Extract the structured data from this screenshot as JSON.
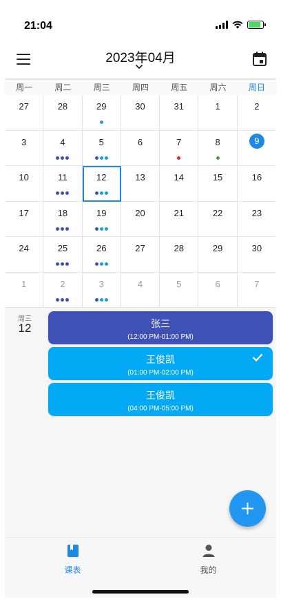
{
  "status_bar": {
    "time": "21:04"
  },
  "app_bar": {
    "title": "2023年04月"
  },
  "weekdays": [
    "周一",
    "周二",
    "周三",
    "周四",
    "周五",
    "周六",
    "周日"
  ],
  "calendar": {
    "days": [
      {
        "n": "27",
        "dim": false,
        "dots": []
      },
      {
        "n": "28",
        "dim": false,
        "dots": []
      },
      {
        "n": "29",
        "dim": false,
        "dots": [
          "#1e9ddf"
        ]
      },
      {
        "n": "30",
        "dim": false,
        "dots": []
      },
      {
        "n": "31",
        "dim": false,
        "dots": []
      },
      {
        "n": "1",
        "dim": false,
        "dots": []
      },
      {
        "n": "2",
        "dim": false,
        "dots": []
      },
      {
        "n": "3",
        "dim": false,
        "dots": []
      },
      {
        "n": "4",
        "dim": false,
        "dots": [
          "#3f51b5",
          "#3f51b5",
          "#3f51b5"
        ]
      },
      {
        "n": "5",
        "dim": false,
        "dots": [
          "#3f51b5",
          "#1e9ddf",
          "#1e9ddf"
        ]
      },
      {
        "n": "6",
        "dim": false,
        "dots": []
      },
      {
        "n": "7",
        "dim": false,
        "dots": [
          "#d32f2f"
        ]
      },
      {
        "n": "8",
        "dim": false,
        "dots": [
          "#43a047"
        ]
      },
      {
        "n": "9",
        "dim": false,
        "today": true,
        "dots": []
      },
      {
        "n": "10",
        "dim": false,
        "dots": []
      },
      {
        "n": "11",
        "dim": false,
        "dots": [
          "#3f51b5",
          "#3f51b5",
          "#3f51b5"
        ]
      },
      {
        "n": "12",
        "dim": false,
        "selected": true,
        "dots": [
          "#3f51b5",
          "#1e9ddf",
          "#1e9ddf"
        ]
      },
      {
        "n": "13",
        "dim": false,
        "dots": []
      },
      {
        "n": "14",
        "dim": false,
        "dots": []
      },
      {
        "n": "15",
        "dim": false,
        "dots": []
      },
      {
        "n": "16",
        "dim": false,
        "dots": []
      },
      {
        "n": "17",
        "dim": false,
        "dots": []
      },
      {
        "n": "18",
        "dim": false,
        "dots": [
          "#3f51b5",
          "#3f51b5",
          "#3f51b5"
        ]
      },
      {
        "n": "19",
        "dim": false,
        "dots": [
          "#3f51b5",
          "#1e9ddf",
          "#1e9ddf"
        ]
      },
      {
        "n": "20",
        "dim": false,
        "dots": []
      },
      {
        "n": "21",
        "dim": false,
        "dots": []
      },
      {
        "n": "22",
        "dim": false,
        "dots": []
      },
      {
        "n": "23",
        "dim": false,
        "dots": []
      },
      {
        "n": "24",
        "dim": false,
        "dots": []
      },
      {
        "n": "25",
        "dim": false,
        "dots": [
          "#3f51b5",
          "#3f51b5",
          "#3f51b5"
        ]
      },
      {
        "n": "26",
        "dim": false,
        "dots": [
          "#3f51b5",
          "#1e9ddf",
          "#1e9ddf"
        ]
      },
      {
        "n": "27",
        "dim": false,
        "dots": []
      },
      {
        "n": "28",
        "dim": false,
        "dots": []
      },
      {
        "n": "29",
        "dim": false,
        "dots": []
      },
      {
        "n": "30",
        "dim": false,
        "dots": []
      },
      {
        "n": "1",
        "dim": true,
        "dots": []
      },
      {
        "n": "2",
        "dim": true,
        "dots": [
          "#3f51b5",
          "#3f51b5",
          "#3f51b5"
        ]
      },
      {
        "n": "3",
        "dim": true,
        "dots": [
          "#3f51b5",
          "#1e9ddf",
          "#1e9ddf"
        ]
      },
      {
        "n": "4",
        "dim": true,
        "dots": []
      },
      {
        "n": "5",
        "dim": true,
        "dots": []
      },
      {
        "n": "6",
        "dim": true,
        "dots": []
      },
      {
        "n": "7",
        "dim": true,
        "dots": []
      }
    ]
  },
  "selected_day": {
    "weekday": "周三",
    "day": "12"
  },
  "events": [
    {
      "title": "张三",
      "time": "(12:00 PM-01:00 PM)",
      "color": "#3f51b5",
      "checked": false
    },
    {
      "title": "王俊凯",
      "time": "(01:00 PM-02:00 PM)",
      "color": "#03a9f4",
      "checked": true
    },
    {
      "title": "王俊凯",
      "time": "(04:00 PM-05:00 PM)",
      "color": "#03a9f4",
      "checked": false
    }
  ],
  "fab": {
    "icon": "plus-icon"
  },
  "nav": {
    "schedule_label": "课表",
    "schedule_icon": "book-icon",
    "profile_label": "我的",
    "profile_icon": "person-icon",
    "active_color": "#1e88e5"
  }
}
